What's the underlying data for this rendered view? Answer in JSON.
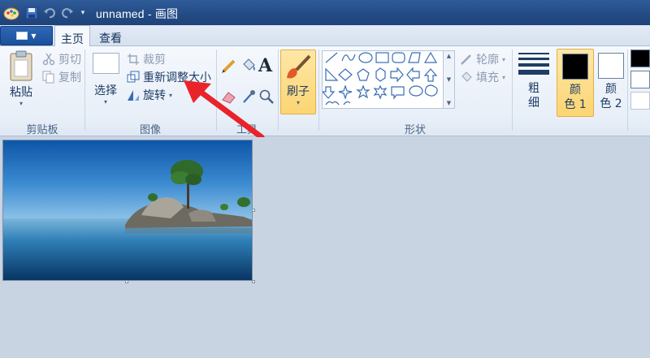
{
  "window": {
    "title": "unnamed - 画图"
  },
  "tabs": [
    {
      "label": "主页",
      "active": true
    },
    {
      "label": "查看",
      "active": false
    }
  ],
  "ribbon": {
    "clipboard": {
      "label": "剪贴板",
      "paste": "粘贴",
      "cut": "剪切",
      "copy": "复制"
    },
    "image": {
      "label": "图像",
      "select": "选择",
      "crop": "裁剪",
      "resize": "重新调整大小",
      "rotate": "旋转"
    },
    "tools": {
      "label": "工具"
    },
    "brushes": {
      "label": "刷子"
    },
    "shapes": {
      "label": "形状",
      "outline": "轮廓",
      "fill": "填充"
    },
    "size": {
      "label_line1": "粗",
      "label_line2": "细"
    },
    "colors": {
      "color1_line1": "颜",
      "color1_line2": "色 1",
      "color2_line1": "颜",
      "color2_line2": "色 2",
      "color1_value": "#000000",
      "color2_value": "#ffffff"
    }
  },
  "colors": {
    "titlebar": "#234a83",
    "active_orange": "#fcd572",
    "annotation_arrow": "#e8242a"
  }
}
